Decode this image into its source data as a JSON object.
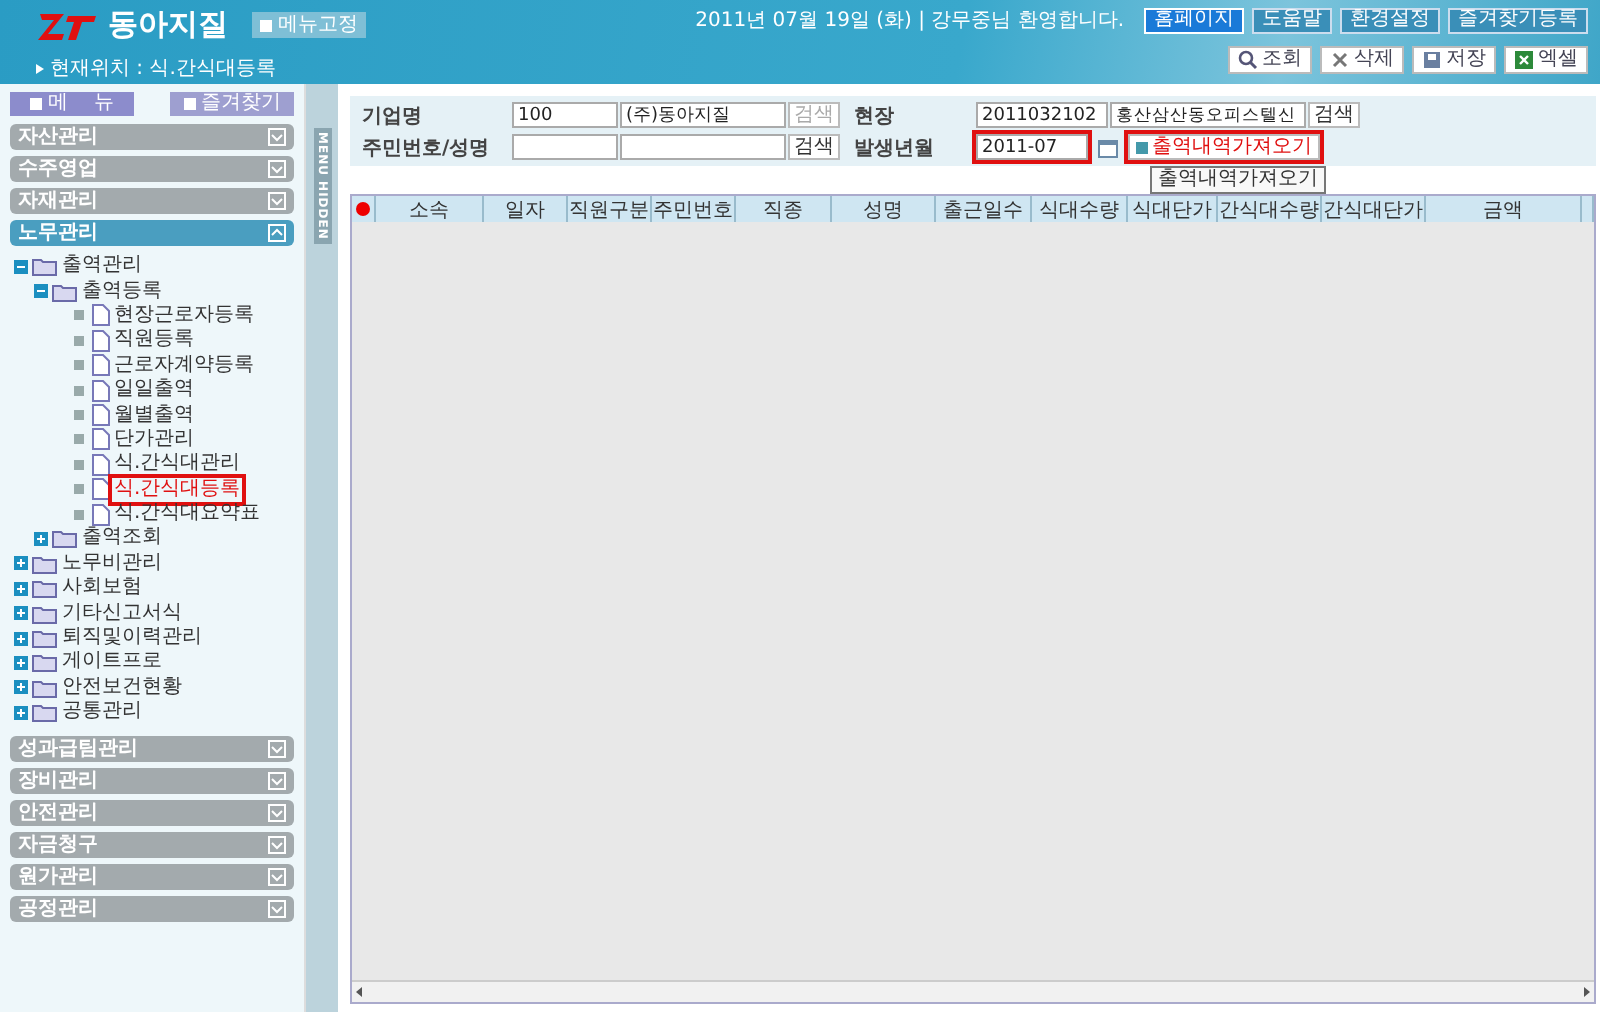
{
  "header": {
    "logo_text": "동아지질",
    "menu_fix_button": "메뉴고정",
    "breadcrumb": "현재위치 : 식.간식대등록",
    "greeting": "2011년 07월 19일 (화) | 강무중님 환영합니다.",
    "top_links": [
      {
        "label": "홈페이지",
        "selected": true
      },
      {
        "label": "도움말",
        "selected": false
      },
      {
        "label": "환경설정",
        "selected": false
      },
      {
        "label": "즐겨찾기등록",
        "selected": false
      }
    ],
    "actions": [
      {
        "label": "조회",
        "kind": "search"
      },
      {
        "label": "삭제",
        "kind": "delete"
      },
      {
        "label": "저장",
        "kind": "save"
      },
      {
        "label": "엑셀",
        "kind": "excel"
      }
    ]
  },
  "sidebar": {
    "tabs": [
      {
        "label": "메    뉴",
        "selected": true
      },
      {
        "label": "즐겨찾기",
        "selected": false
      }
    ],
    "sections": [
      {
        "label": "자산관리",
        "expanded": false
      },
      {
        "label": "수주영업",
        "expanded": false
      },
      {
        "label": "자재관리",
        "expanded": false
      },
      {
        "label": "노무관리",
        "expanded": true,
        "tree": [
          {
            "label": "출역관리",
            "kind": "folder",
            "expanded": true,
            "children": [
              {
                "label": "출역등록",
                "kind": "folder",
                "expanded": true,
                "children": [
                  {
                    "label": "현장근로자등록",
                    "kind": "page",
                    "selected": false
                  },
                  {
                    "label": "직원등록",
                    "kind": "page",
                    "selected": false
                  },
                  {
                    "label": "근로자계약등록",
                    "kind": "page",
                    "selected": false
                  },
                  {
                    "label": "일일출역",
                    "kind": "page",
                    "selected": false
                  },
                  {
                    "label": "월별출역",
                    "kind": "page",
                    "selected": false
                  },
                  {
                    "label": "단가관리",
                    "kind": "page",
                    "selected": false
                  },
                  {
                    "label": "식.간식대관리",
                    "kind": "page",
                    "selected": false
                  },
                  {
                    "label": "식.간식대등록",
                    "kind": "page",
                    "selected": true
                  },
                  {
                    "label": "식.간식대요약표",
                    "kind": "page",
                    "selected": false
                  }
                ]
              },
              {
                "label": "출역조회",
                "kind": "folder",
                "expanded": false
              }
            ]
          },
          {
            "label": "노무비관리",
            "kind": "folder",
            "expanded": false
          },
          {
            "label": "사회보험",
            "kind": "folder",
            "expanded": false
          },
          {
            "label": "기타신고서식",
            "kind": "folder",
            "expanded": false
          },
          {
            "label": "퇴직및이력관리",
            "kind": "folder",
            "expanded": false
          },
          {
            "label": "게이트프로",
            "kind": "folder",
            "expanded": false
          },
          {
            "label": "안전보건현황",
            "kind": "folder",
            "expanded": false
          },
          {
            "label": "공통관리",
            "kind": "folder",
            "expanded": false
          }
        ]
      },
      {
        "label": "성과급팀관리",
        "expanded": false
      },
      {
        "label": "장비관리",
        "expanded": false
      },
      {
        "label": "안전관리",
        "expanded": false
      },
      {
        "label": "자금청구",
        "expanded": false
      },
      {
        "label": "원가관리",
        "expanded": false
      },
      {
        "label": "공정관리",
        "expanded": false
      }
    ]
  },
  "menu_hidden_handle": "MENU HIDDEN",
  "form": {
    "company": {
      "label": "기업명",
      "code": "100",
      "name": "(주)동아지질",
      "search": "검색",
      "search_disabled": true
    },
    "site": {
      "label": "현장",
      "code": "2011032102",
      "name": "홍산삼산동오피스텔신",
      "search": "검색"
    },
    "person": {
      "label": "주민번호/성명",
      "search": "검색"
    },
    "month": {
      "label": "발생년월",
      "value": "2011-07",
      "highlighted": true
    },
    "fetch_button": {
      "label": "출역내역가져오기",
      "highlighted": true
    },
    "tooltip": "출역내역가져오기"
  },
  "table": {
    "columns": [
      "소속",
      "일자",
      "직원구분",
      "주민번호",
      "직종",
      "성명",
      "출근일수",
      "식대수량",
      "식대단가",
      "간식대수량",
      "간식대단가",
      "금액"
    ]
  }
}
